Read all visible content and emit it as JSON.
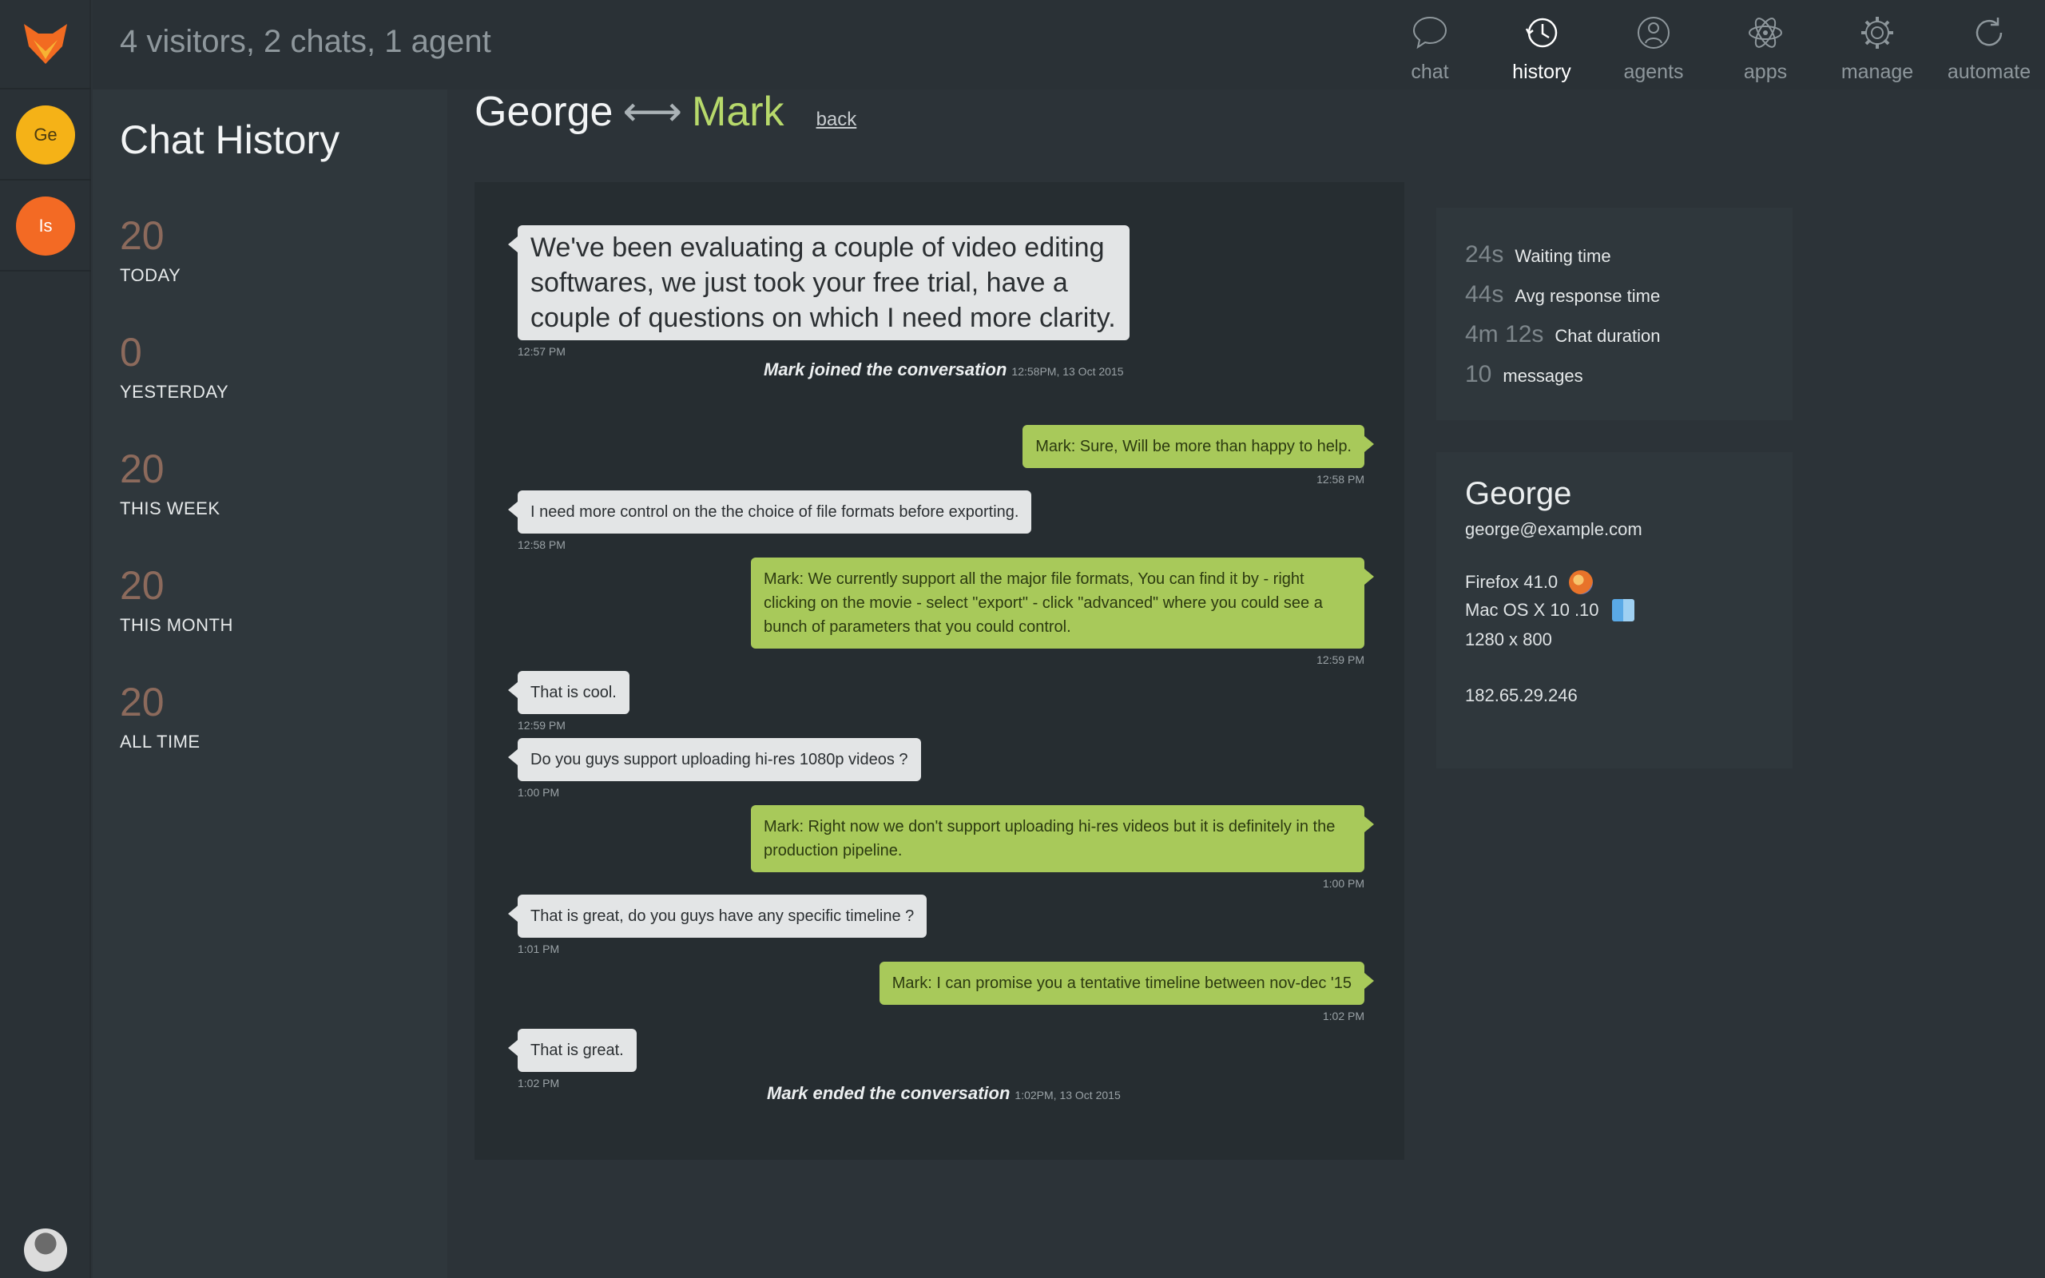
{
  "header": {
    "status": "4 visitors, 2 chats, 1 agent",
    "nav": [
      {
        "label": "chat",
        "icon": "chat-bubble-icon",
        "active": false
      },
      {
        "label": "history",
        "icon": "history-clock-icon",
        "active": true
      },
      {
        "label": "agents",
        "icon": "agent-person-icon",
        "active": false
      },
      {
        "label": "apps",
        "icon": "atom-icon",
        "active": false
      },
      {
        "label": "manage",
        "icon": "gear-icon",
        "active": false
      },
      {
        "label": "automate",
        "icon": "refresh-icon",
        "active": false
      }
    ]
  },
  "rail": {
    "logo": "fox-logo-icon",
    "visitors": [
      {
        "initials": "Ge",
        "color": "#f5b217"
      },
      {
        "initials": "Is",
        "color": "#f36a24"
      }
    ]
  },
  "history": {
    "title": "Chat History",
    "stats": [
      {
        "value": "20",
        "label": "TODAY"
      },
      {
        "value": "0",
        "label": "YESTERDAY"
      },
      {
        "value": "20",
        "label": "THIS WEEK"
      },
      {
        "value": "20",
        "label": "THIS MONTH"
      },
      {
        "value": "20",
        "label": "ALL TIME"
      }
    ]
  },
  "conversation": {
    "visitor": "George",
    "agent": "Mark",
    "arrow": "⟷",
    "back_label": "back",
    "messages": [
      {
        "from": "visitor",
        "text": "We've been evaluating a couple of video editing softwares, we just took your free trial, have a couple of questions on which I need more clarity.",
        "time": "12:57 PM"
      },
      {
        "from": "system",
        "text": "Mark joined the conversation",
        "time": "12:58PM, 13 Oct 2015"
      },
      {
        "from": "agent",
        "text": "Mark: Sure, Will be more than happy to help.",
        "time": "12:58 PM"
      },
      {
        "from": "visitor",
        "text": "I need more control on the the choice of file formats before exporting.",
        "time": "12:58 PM"
      },
      {
        "from": "agent",
        "text": "Mark: We currently support all the major file formats, You can find it by - right clicking on the movie - select \"export\" - click \"advanced\" where you could see a bunch of parameters that you could control.",
        "time": "12:59 PM"
      },
      {
        "from": "visitor",
        "text": "That is cool.",
        "time": "12:59 PM"
      },
      {
        "from": "visitor",
        "text": "Do you guys support uploading hi-res 1080p videos ?",
        "time": "1:00 PM"
      },
      {
        "from": "agent",
        "text": "Mark: Right now we don't support uploading hi-res videos but it is definitely in the production pipeline.",
        "time": "1:00 PM"
      },
      {
        "from": "visitor",
        "text": "That is great, do you guys have any specific timeline ?",
        "time": "1:01 PM"
      },
      {
        "from": "agent",
        "text": "Mark: I can promise you a tentative timeline between nov-dec '15",
        "time": "1:02 PM"
      },
      {
        "from": "visitor",
        "text": "That is great.",
        "time": "1:02 PM"
      },
      {
        "from": "system",
        "text": "Mark ended the conversation",
        "time": "1:02PM, 13 Oct 2015"
      }
    ]
  },
  "chat_stats": [
    {
      "value": "24s",
      "label": "Waiting time"
    },
    {
      "value": "44s",
      "label": "Avg response time"
    },
    {
      "value": "4m 12s",
      "label": "Chat duration"
    },
    {
      "value": "10",
      "label": "messages"
    }
  ],
  "visitor_info": {
    "name": "George",
    "email": "george@example.com",
    "browser": "Firefox 41.0",
    "os": "Mac OS X 10 .10",
    "resolution": "1280 x 800",
    "ip": "182.65.29.246"
  }
}
